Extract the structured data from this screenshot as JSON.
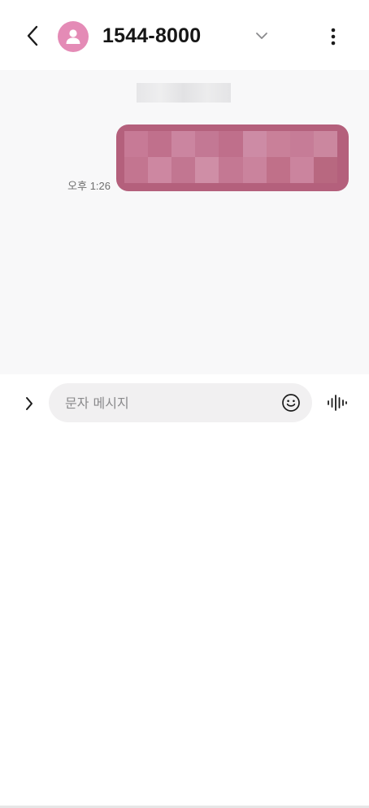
{
  "header": {
    "title": "1544-8000",
    "back_icon": "chevron-left-icon",
    "avatar_icon": "person-icon",
    "avatar_color": "#e48bb6",
    "expand_icon": "chevron-down-icon",
    "more_icon": "more-vertical-icon"
  },
  "conversation": {
    "background": "#f8f8f9",
    "date_label_redacted": true,
    "messages": [
      {
        "direction": "outgoing",
        "time": "오후 1:26",
        "text_redacted": true,
        "bubble_color": "#b4607c"
      }
    ]
  },
  "composer": {
    "placeholder": "문자 메시지",
    "value": "",
    "expand_icon": "chevron-right-icon",
    "emoji_icon": "smiley-icon",
    "voice_icon": "voice-waveform-icon"
  }
}
